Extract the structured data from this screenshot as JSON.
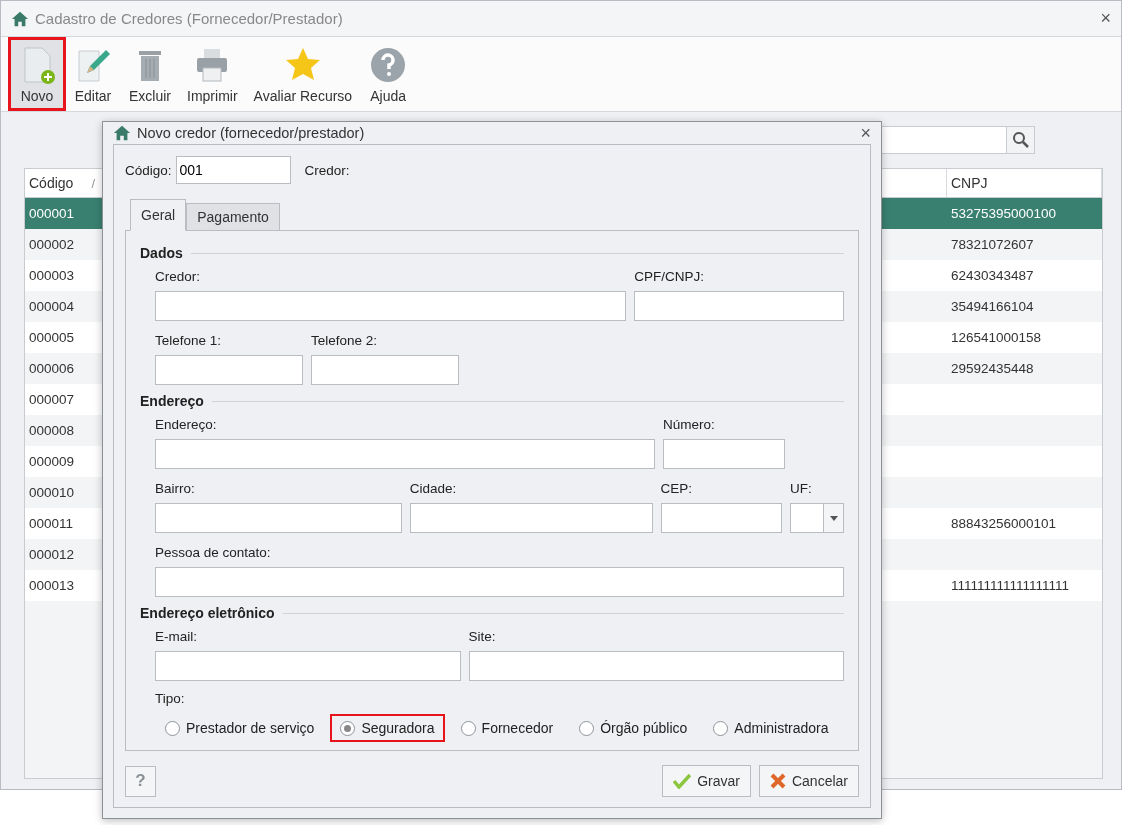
{
  "window": {
    "title": "Cadastro de Credores (Fornecedor/Prestador)",
    "close": "×"
  },
  "toolbar": [
    {
      "label": "Novo",
      "kind": "new",
      "highlighted": true
    },
    {
      "label": "Editar",
      "kind": "edit",
      "highlighted": false
    },
    {
      "label": "Excluir",
      "kind": "delete",
      "highlighted": false
    },
    {
      "label": "Imprimir",
      "kind": "print",
      "highlighted": false
    },
    {
      "label": "Avaliar Recurso",
      "kind": "star",
      "highlighted": false
    },
    {
      "label": "Ajuda",
      "kind": "help",
      "highlighted": false
    }
  ],
  "table": {
    "columns": [
      "Código",
      "CNPJ"
    ],
    "sort_mark": "/",
    "rows": [
      {
        "code": "000001",
        "cnpj": "53275395000100",
        "selected": true
      },
      {
        "code": "000002",
        "cnpj": "78321072607",
        "selected": false
      },
      {
        "code": "000003",
        "cnpj": "62430343487",
        "selected": false
      },
      {
        "code": "000004",
        "cnpj": "35494166104",
        "selected": false
      },
      {
        "code": "000005",
        "cnpj": "126541000158",
        "selected": false
      },
      {
        "code": "000006",
        "cnpj": "29592435448",
        "selected": false
      },
      {
        "code": "000007",
        "cnpj": "",
        "selected": false
      },
      {
        "code": "000008",
        "cnpj": "",
        "selected": false
      },
      {
        "code": "000009",
        "cnpj": "",
        "selected": false
      },
      {
        "code": "000010",
        "cnpj": "",
        "selected": false
      },
      {
        "code": "000011",
        "cnpj": "88843256000101",
        "selected": false
      },
      {
        "code": "000012",
        "cnpj": "",
        "selected": false
      },
      {
        "code": "000013",
        "cnpj": "111111111111111111",
        "selected": false
      }
    ]
  },
  "dialog": {
    "title": "Novo credor (fornecedor/prestador)",
    "close": "×",
    "code_label": "Código:",
    "code_value": "001",
    "creditor_label": "Credor:",
    "tabs": [
      {
        "label": "Geral",
        "selected": true
      },
      {
        "label": "Pagamento",
        "selected": false
      }
    ],
    "sections": [
      {
        "title": "Dados",
        "fields": [
          {
            "label": "Credor:",
            "kind": "text"
          },
          {
            "label": "CPF/CNPJ:",
            "kind": "text"
          },
          {
            "label": "Telefone 1:",
            "kind": "text"
          },
          {
            "label": "Telefone 2:",
            "kind": "text"
          }
        ]
      },
      {
        "title": "Endereço",
        "fields": [
          {
            "label": "Endereço:",
            "kind": "text"
          },
          {
            "label": "Número:",
            "kind": "text"
          },
          {
            "label": "Bairro:",
            "kind": "text"
          },
          {
            "label": "Cidade:",
            "kind": "text"
          },
          {
            "label": "CEP:",
            "kind": "text"
          },
          {
            "label": "UF:",
            "kind": "select"
          },
          {
            "label": "Pessoa de contato:",
            "kind": "text"
          }
        ]
      },
      {
        "title": "Endereço eletrônico",
        "fields": [
          {
            "label": "E-mail:",
            "kind": "text"
          },
          {
            "label": "Site:",
            "kind": "text"
          }
        ]
      }
    ],
    "type_label": "Tipo:",
    "types": [
      {
        "label": "Prestador de serviço",
        "selected": false,
        "highlighted": false
      },
      {
        "label": "Seguradora",
        "selected": true,
        "highlighted": true
      },
      {
        "label": "Fornecedor",
        "selected": false,
        "highlighted": false
      },
      {
        "label": "Órgão público",
        "selected": false,
        "highlighted": false
      },
      {
        "label": "Administradora",
        "selected": false,
        "highlighted": false
      }
    ],
    "help": "?",
    "buttons": [
      {
        "label": "Gravar",
        "kind": "save"
      },
      {
        "label": "Cancelar",
        "kind": "cancel"
      }
    ]
  }
}
